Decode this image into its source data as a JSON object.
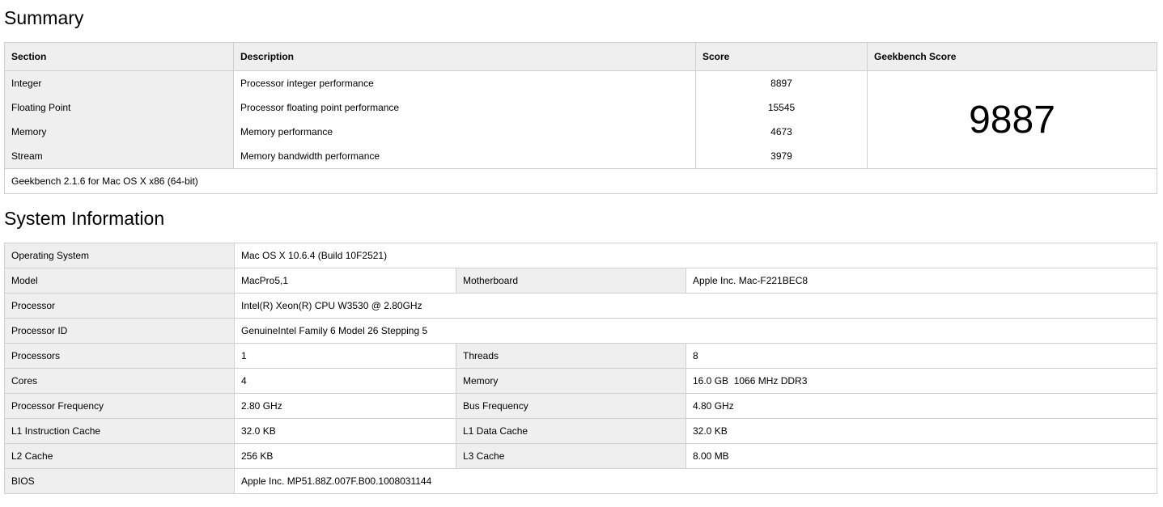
{
  "summary": {
    "heading": "Summary",
    "headers": {
      "section": "Section",
      "description": "Description",
      "score": "Score",
      "geekbench": "Geekbench Score"
    },
    "rows": [
      {
        "section": "Integer",
        "description": "Processor integer performance",
        "score": "8897"
      },
      {
        "section": "Floating Point",
        "description": "Processor floating point performance",
        "score": "15545"
      },
      {
        "section": "Memory",
        "description": "Memory performance",
        "score": "4673"
      },
      {
        "section": "Stream",
        "description": "Memory bandwidth performance",
        "score": "3979"
      }
    ],
    "geekbench_score": "9887",
    "footer": "Geekbench 2.1.6 for Mac OS X x86 (64-bit)"
  },
  "system": {
    "heading": "System Information",
    "os": {
      "label": "Operating System",
      "value": "Mac OS X 10.6.4 (Build 10F2521)"
    },
    "model": {
      "label": "Model",
      "value": "MacPro5,1"
    },
    "motherboard": {
      "label": "Motherboard",
      "value": "Apple Inc. Mac-F221BEC8"
    },
    "processor": {
      "label": "Processor",
      "value": "Intel(R) Xeon(R) CPU W3530 @ 2.80GHz"
    },
    "processor_id": {
      "label": "Processor ID",
      "value": "GenuineIntel Family 6 Model 26 Stepping 5"
    },
    "processors": {
      "label": "Processors",
      "value": "1"
    },
    "threads": {
      "label": "Threads",
      "value": "8"
    },
    "cores": {
      "label": "Cores",
      "value": "4"
    },
    "memory": {
      "label": "Memory",
      "value": "16.0 GB  1066 MHz DDR3"
    },
    "proc_freq": {
      "label": "Processor Frequency",
      "value": "2.80 GHz"
    },
    "bus_freq": {
      "label": "Bus Frequency",
      "value": "4.80 GHz"
    },
    "l1i": {
      "label": "L1 Instruction Cache",
      "value": "32.0 KB"
    },
    "l1d": {
      "label": "L1 Data Cache",
      "value": "32.0 KB"
    },
    "l2": {
      "label": "L2 Cache",
      "value": "256 KB"
    },
    "l3": {
      "label": "L3 Cache",
      "value": "8.00 MB"
    },
    "bios": {
      "label": "BIOS",
      "value": "Apple Inc. MP51.88Z.007F.B00.1008031144"
    }
  }
}
